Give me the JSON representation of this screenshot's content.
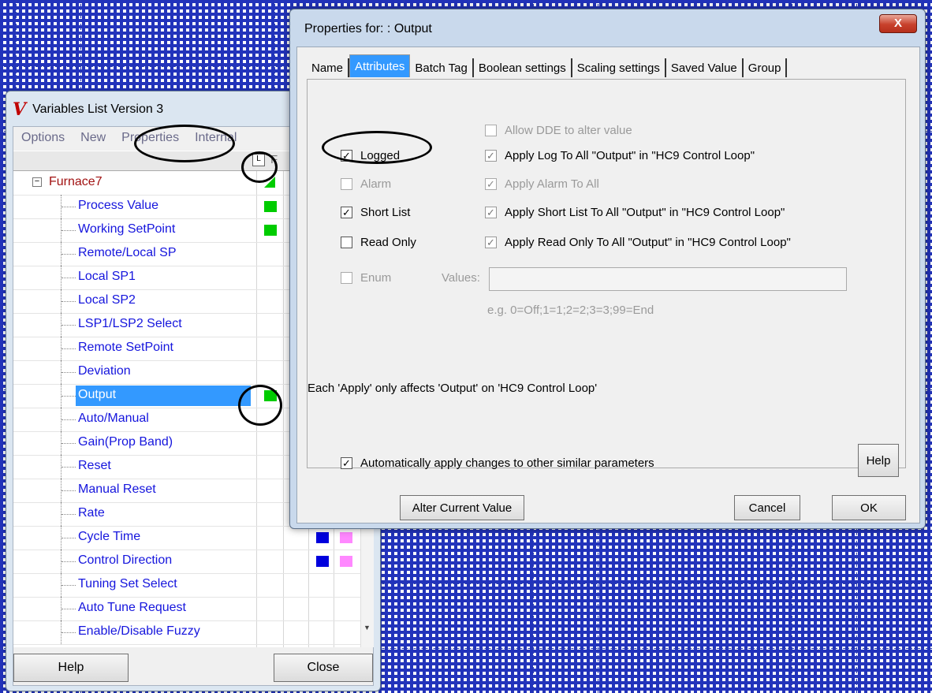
{
  "var_window": {
    "title": "Variables List Version 3",
    "logo": "V",
    "menu": [
      "Options",
      "New",
      "Properties",
      "Internal"
    ],
    "header_icon": "L",
    "header_partial": "F",
    "root": "Furnace7",
    "expander": "−",
    "items": [
      {
        "label": "Process Value",
        "marks": [
          "green"
        ]
      },
      {
        "label": "Working SetPoint",
        "marks": [
          "green"
        ]
      },
      {
        "label": "Remote/Local SP",
        "marks": []
      },
      {
        "label": "Local SP1",
        "marks": []
      },
      {
        "label": "Local SP2",
        "marks": []
      },
      {
        "label": "LSP1/LSP2 Select",
        "marks": []
      },
      {
        "label": "Remote SetPoint",
        "marks": []
      },
      {
        "label": "Deviation",
        "marks": []
      },
      {
        "label": "Output",
        "marks": [
          "green"
        ],
        "selected": true
      },
      {
        "label": "Auto/Manual",
        "marks": []
      },
      {
        "label": "Gain(Prop Band)",
        "marks": []
      },
      {
        "label": "Reset",
        "marks": []
      },
      {
        "label": "Manual Reset",
        "marks": []
      },
      {
        "label": "Rate",
        "marks": []
      },
      {
        "label": "Cycle Time",
        "marks": [
          "blue",
          "pink"
        ]
      },
      {
        "label": "Control Direction",
        "marks": [
          "blue",
          "pink"
        ]
      },
      {
        "label": "Tuning Set Select",
        "marks": []
      },
      {
        "label": "Auto Tune Request",
        "marks": []
      },
      {
        "label": "Enable/Disable Fuzzy",
        "marks": []
      }
    ],
    "help_label": "Help",
    "close_label": "Close"
  },
  "props": {
    "title": "Properties for: : Output",
    "close_glyph": "X",
    "tabs": [
      "Name",
      "Attributes",
      "Batch Tag",
      "Boolean settings",
      "Scaling settings",
      "Saved Value",
      "Group"
    ],
    "active_tab": "Attributes",
    "allow_dde": "Allow DDE to alter value",
    "logged": "Logged",
    "apply_log": "Apply Log To All \"Output\" in \"HC9 Control Loop\"",
    "alarm": "Alarm",
    "apply_alarm": "Apply Alarm To All",
    "short_list": "Short List",
    "apply_short_list": "Apply Short List To All \"Output\" in \"HC9 Control Loop\"",
    "read_only": "Read Only",
    "apply_read_only": "Apply Read Only To All \"Output\" in \"HC9 Control Loop\"",
    "enum": "Enum",
    "values_label": "Values:",
    "values_value": "",
    "example": "e.g. 0=Off;1=1;2=2;3=3;99=End",
    "note": "Each 'Apply' only affects 'Output'  on 'HC9 Control Loop'",
    "auto_apply": "Automatically apply changes to other similar parameters",
    "check_glyph": "✓",
    "help_label": "Help",
    "alter_label": "Alter Current Value",
    "cancel_label": "Cancel",
    "ok_label": "OK"
  },
  "colors": {
    "selection": "#3399ff",
    "tree_text": "#1515dd",
    "root_text": "#a11111",
    "green": "#00cc00",
    "blue": "#0000dd",
    "pink": "#ff88ff"
  }
}
